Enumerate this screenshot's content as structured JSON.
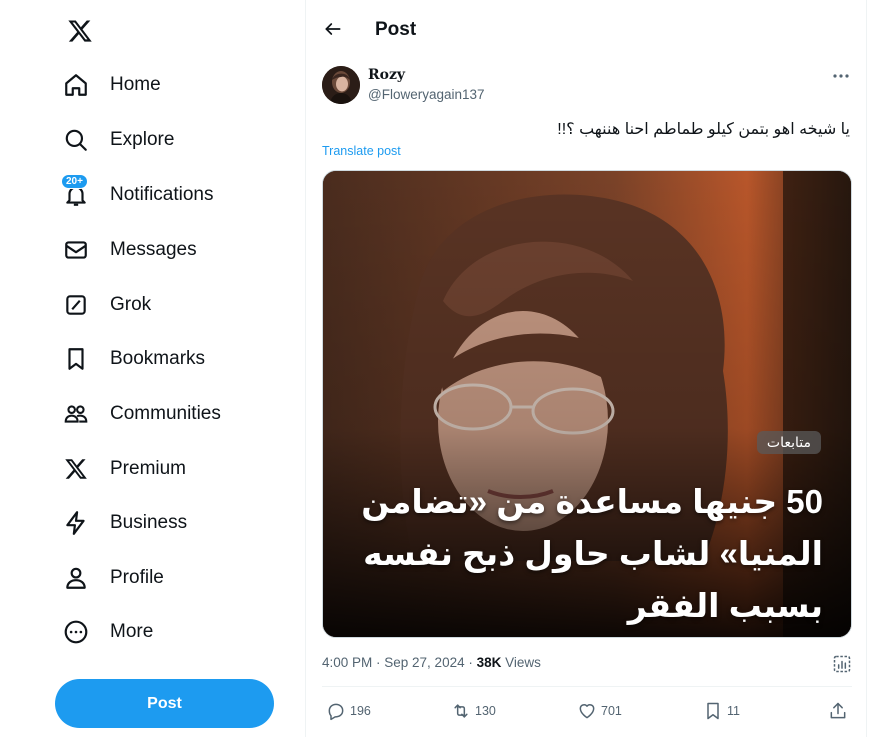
{
  "sidebar": {
    "logo": "x-logo-icon",
    "items": [
      {
        "label": "Home",
        "icon": "home-icon"
      },
      {
        "label": "Explore",
        "icon": "search-icon"
      },
      {
        "label": "Notifications",
        "icon": "bell-icon",
        "badge": "20+"
      },
      {
        "label": "Messages",
        "icon": "envelope-icon"
      },
      {
        "label": "Grok",
        "icon": "grok-icon"
      },
      {
        "label": "Bookmarks",
        "icon": "bookmark-icon"
      },
      {
        "label": "Communities",
        "icon": "communities-icon"
      },
      {
        "label": "Premium",
        "icon": "x-premium-icon"
      },
      {
        "label": "Business",
        "icon": "lightning-icon"
      },
      {
        "label": "Profile",
        "icon": "person-icon"
      },
      {
        "label": "More",
        "icon": "more-circle-icon"
      }
    ],
    "post_button": "Post"
  },
  "header": {
    "title": "Post"
  },
  "post": {
    "author_name": "Rozy",
    "author_handle": "@Floweryagain137",
    "text": "يا شيخه اهو بتمن كيلو طماطم احنا هننهب ؟!!",
    "translate_label": "Translate post",
    "media": {
      "tag": "متابعات",
      "headline": "50 جنيها مساعدة من «تضامن المنيا» لشاب حاول ذبح نفسه بسبب الفقر"
    },
    "timestamp": "4:00 PM · Sep 27, 2024 · ",
    "views_count": "38K",
    "views_label": " Views",
    "actions": {
      "replies": "196",
      "reposts": "130",
      "likes": "701",
      "bookmarks": "11"
    }
  },
  "colors": {
    "accent": "#1d9bf0",
    "text_primary": "#0f1419",
    "text_secondary": "#536471"
  }
}
